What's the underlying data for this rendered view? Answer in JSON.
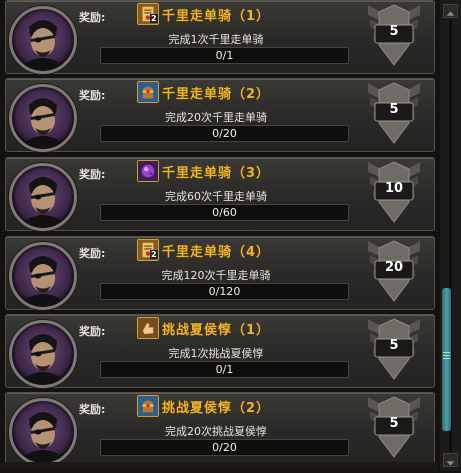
{
  "quests": [
    {
      "reward_label": "奖励:",
      "item_icon": "scroll-icon",
      "item_count": "2",
      "title": "千里走单骑（1）",
      "description": "完成1次千里走单骑",
      "progress": "0/1",
      "progress_fraction": 0,
      "points": "5"
    },
    {
      "reward_label": "奖励:",
      "item_icon": "treasure-bag-icon",
      "item_count": "",
      "title": "千里走单骑（2）",
      "description": "完成20次千里走单骑",
      "progress": "0/20",
      "progress_fraction": 0,
      "points": "5"
    },
    {
      "reward_label": "奖励:",
      "item_icon": "purple-gem-icon",
      "item_count": "",
      "title": "千里走单骑（3）",
      "description": "完成60次千里走单骑",
      "progress": "0/60",
      "progress_fraction": 0,
      "points": "10"
    },
    {
      "reward_label": "奖励:",
      "item_icon": "scroll-icon",
      "item_count": "2",
      "title": "千里走单骑（4）",
      "description": "完成120次千里走单骑",
      "progress": "0/120",
      "progress_fraction": 0,
      "points": "20"
    },
    {
      "reward_label": "奖励:",
      "item_icon": "hand-icon",
      "item_count": "",
      "title": "挑战夏侯惇（1）",
      "description": "完成1次挑战夏侯惇",
      "progress": "0/1",
      "progress_fraction": 0,
      "points": "5"
    },
    {
      "reward_label": "奖励:",
      "item_icon": "treasure-bag-icon",
      "item_count": "",
      "title": "挑战夏侯惇（2）",
      "description": "完成20次挑战夏侯惇",
      "progress": "0/20",
      "progress_fraction": 0,
      "points": "5"
    }
  ],
  "colors": {
    "title": "#f4b31a",
    "panel": "#2a2927",
    "scroll_thumb": "#4d9faa"
  },
  "scrollbar": {
    "up_icon": "arrow-up-icon",
    "down_icon": "arrow-down-icon",
    "position_fraction": 0.62
  }
}
